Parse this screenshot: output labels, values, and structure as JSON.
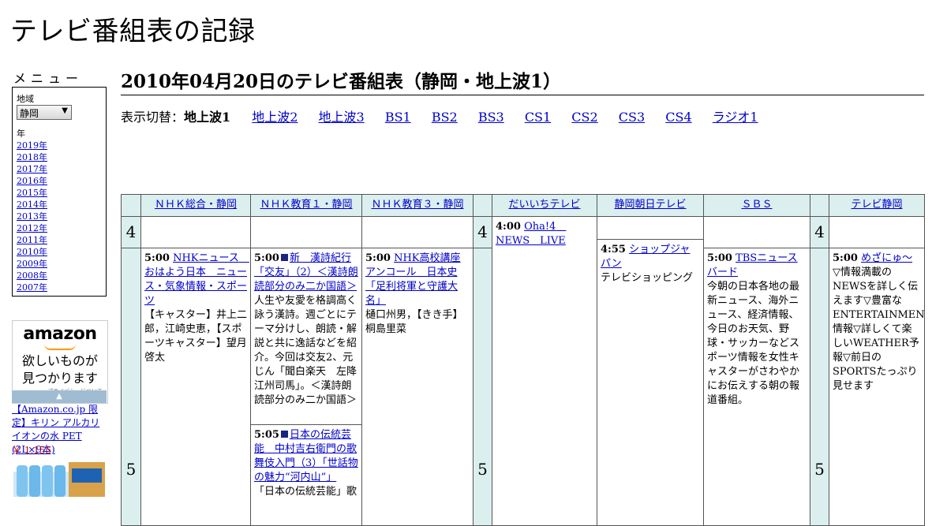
{
  "site": {
    "title": "テレビ番組表の記録"
  },
  "menu": {
    "title": "メニュー",
    "region_label": "地域",
    "region_value": "静岡",
    "year_label": "年",
    "years": [
      "2019年",
      "2018年",
      "2017年",
      "2016年",
      "2015年",
      "2014年",
      "2013年",
      "2012年",
      "2011年",
      "2010年",
      "2009年",
      "2008年",
      "2007年"
    ]
  },
  "ad": {
    "logo": "amazon",
    "line1": "欲しいものが",
    "line2": "見つかります",
    "privacy": "プライバシーについて",
    "product_title": "【Amazon.co.jp 限定】キリン アルカリイオンの水 PET (2L×9本)",
    "price": "￥ 1,155"
  },
  "page": {
    "heading": "2010年04月20日のテレビ番組表（静岡・地上波1）",
    "switch_label": "表示切替：",
    "current": "地上波1",
    "links": [
      "地上波2",
      "地上波3",
      "BS1",
      "BS2",
      "BS3",
      "CS1",
      "CS2",
      "CS3",
      "CS4",
      "ラジオ1"
    ]
  },
  "channels": [
    "ＮＨＫ総合・静岡",
    "ＮＨＫ教育１・静岡",
    "ＮＨＫ教育３・静岡",
    "だいいちテレビ",
    "静岡朝日テレビ",
    "ＳＢＳ",
    "テレビ静岡"
  ],
  "hours": [
    "4",
    "5"
  ],
  "programs": {
    "nhk_g_5": {
      "time": "5:00",
      "title": "NHKニュース　おはよう日本　ニュース・気象情報・スポーツ",
      "desc": "【キャスター】井上二郎，江崎史恵，【スポーツキャスター】望月啓太"
    },
    "nhk_e1_5": {
      "time": "5:00",
      "title": "新　漢詩紀行「交友」（2）＜漢詩朗読部分のみ二か国語＞",
      "desc": "人生や友愛を格調高く詠う漢詩。週ごとにテーマ分けし、朗読・解説と共に逸話などを紹介。今回は交友2、元じん「聞白楽天　左降江州司馬」。＜漢詩朗読部分のみ二か国語＞"
    },
    "nhk_e1_505": {
      "time": "5:05",
      "title": "日本の伝統芸能　中村吉右衛門の歌舞伎入門（3）「世話物の魅力“河内山”」",
      "desc": "「日本の伝統芸能」歌"
    },
    "nhk_e3_5": {
      "time": "5:00",
      "title": "NHK高校講座アンコール　日本史「足利将軍と守護大名」",
      "desc": "樋口州男，【きき手】桐島里菜"
    },
    "daiichi_4": {
      "time": "4:00",
      "title": "Oha!4　NEWS　LIVE"
    },
    "asahi_455": {
      "time": "4:55",
      "title": "ショップジャパン",
      "desc": "テレビショッピング"
    },
    "sbs_5": {
      "time": "5:00",
      "title": "TBSニュースバード",
      "desc": "今朝の日本各地の最新ニュース、海外ニュース、経済情報、今日のお天気、野球・サッカーなどスポーツ情報を女性キャスターがさわやかにお伝えする朝の報道番組。"
    },
    "tvs_5": {
      "time": "5:00",
      "title": "めざにゅ～",
      "desc": "▽情報満載のNEWSを詳しく伝えます▽豊富なENTERTAINMENT情報▽詳しくて楽しいWEATHER予報▽前日のSPORTSたっぷり見せます"
    }
  }
}
